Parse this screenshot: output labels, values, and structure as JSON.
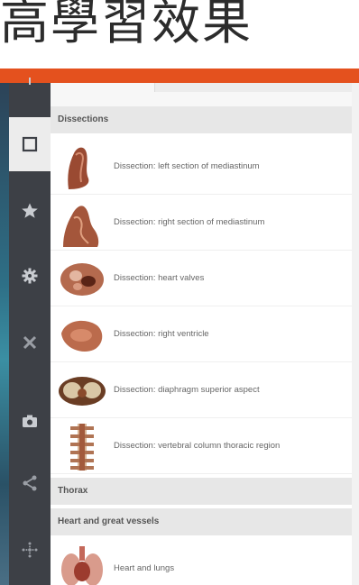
{
  "slide": {
    "title": "高學習效果"
  },
  "toolbar": {
    "items": [
      {
        "name": "view-icon",
        "active": true
      },
      {
        "name": "star-icon"
      },
      {
        "name": "gear-icon"
      },
      {
        "name": "close-icon"
      },
      {
        "name": "camera-icon"
      },
      {
        "name": "share-icon"
      },
      {
        "name": "move-icon"
      }
    ]
  },
  "panel": {
    "sections": [
      {
        "title": "Dissections"
      },
      {
        "title": "Thorax"
      },
      {
        "title": "Heart and great vessels"
      }
    ],
    "items": [
      {
        "label": "Dissection: left section of mediastinum"
      },
      {
        "label": "Dissection: right section of mediastinum"
      },
      {
        "label": "Dissection: heart valves"
      },
      {
        "label": "Dissection: right ventricle"
      },
      {
        "label": "Dissection: diaphragm superior aspect"
      },
      {
        "label": "Dissection: vertebral column thoracic region"
      },
      {
        "label": "Heart and lungs"
      }
    ]
  },
  "colors": {
    "accent": "#e4511e",
    "toolbar": "#3d4046",
    "section": "#e7e7e7"
  }
}
